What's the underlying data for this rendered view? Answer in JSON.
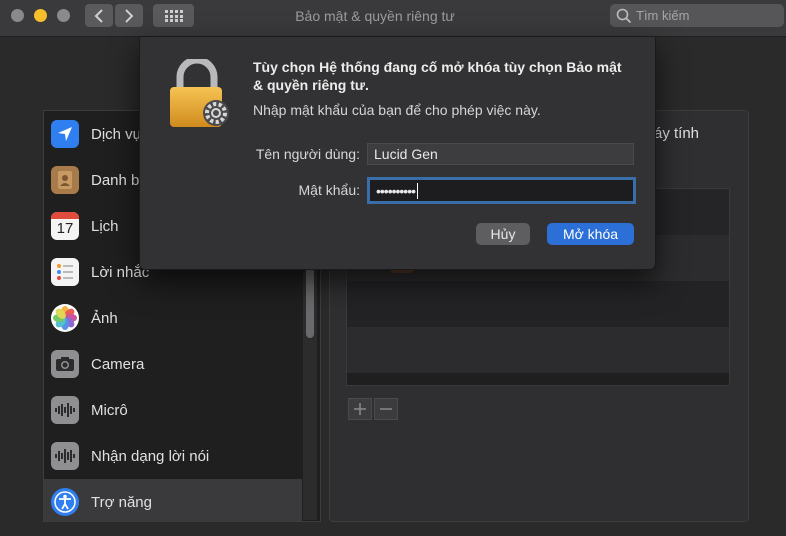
{
  "window": {
    "title": "Bảo mật & quyền riêng tư"
  },
  "search": {
    "placeholder": "Tìm kiếm"
  },
  "colors": {
    "accent": "#2c6fd6",
    "close": "#8a8a8c",
    "minimize": "#f5be2a",
    "zoom": "#8a8a8c"
  },
  "sidebar": {
    "items": [
      {
        "label": "Dịch vụ",
        "icon": "location-arrow-icon"
      },
      {
        "label": "Danh b",
        "icon": "contacts-book-icon"
      },
      {
        "label": "Lịch",
        "icon": "calendar-icon",
        "day": "17"
      },
      {
        "label": "Lời nhắc",
        "icon": "reminders-icon"
      },
      {
        "label": "Ảnh",
        "icon": "photos-icon"
      },
      {
        "label": "Camera",
        "icon": "camera-icon"
      },
      {
        "label": "Micrô",
        "icon": "microphone-icon"
      },
      {
        "label": "Nhận dạng lời nói",
        "icon": "speech-recognition-icon"
      },
      {
        "label": "Trợ năng",
        "icon": "accessibility-icon",
        "selected": true
      }
    ]
  },
  "right_panel": {
    "partial_text": "áy tính"
  },
  "dialog": {
    "title": "Tùy chọn Hệ thống đang cố mở khóa tùy chọn Bảo mật & quyền riêng tư.",
    "message": "Nhập mật khẩu của bạn để cho phép việc này.",
    "username_label": "Tên người dùng:",
    "username_value": "Lucid Gen",
    "password_label": "Mật khẩu:",
    "password_value": "••••••••••",
    "cancel_label": "Hủy",
    "unlock_label": "Mở khóa"
  }
}
